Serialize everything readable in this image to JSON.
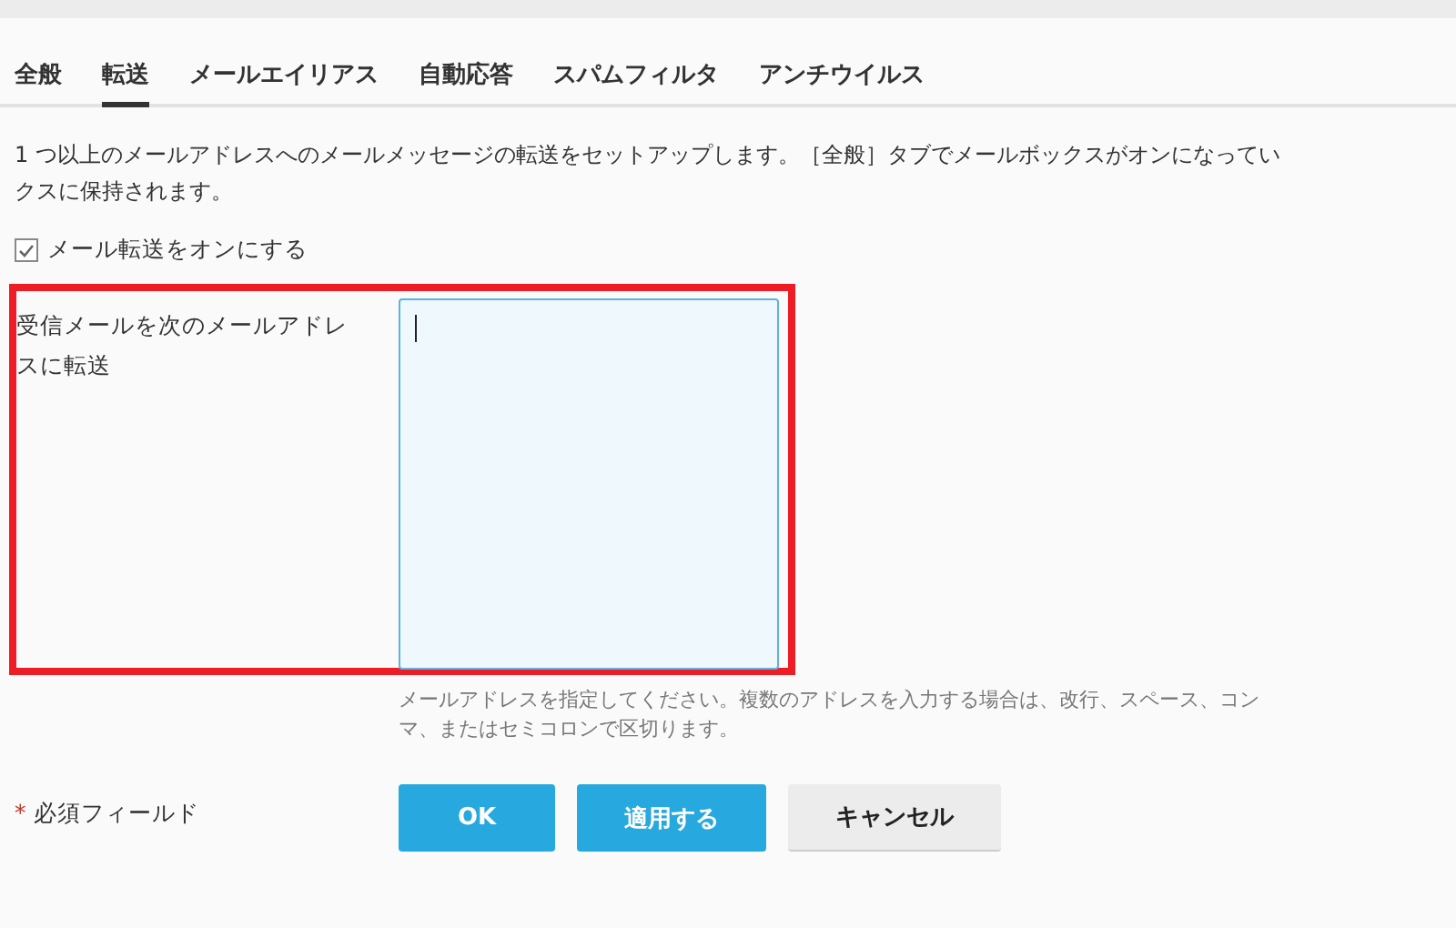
{
  "tabs": [
    {
      "label": "全般",
      "selected": false
    },
    {
      "label": "転送",
      "selected": true
    },
    {
      "label": "メールエイリアス",
      "selected": false
    },
    {
      "label": "自動応答",
      "selected": false
    },
    {
      "label": "スパムフィルタ",
      "selected": false
    },
    {
      "label": "アンチウイルス",
      "selected": false
    }
  ],
  "description": [
    "1 つ以上のメールアドレスへのメールメッセージの転送をセットアップします。［全般］タブでメールボックスがオンになってい",
    "クスに保持されます。"
  ],
  "forwarding_toggle": {
    "label": "メール転送をオンにする",
    "checked": true
  },
  "forward_section": {
    "highlighted": true,
    "label": "受信メールを次のメールアドレスに転送",
    "focused": true,
    "hint": "メールアドレスを指定してください。複数のアドレスを入力する場合は、改行、スペース、コンマ、またはセミコロンで区切ります。"
  },
  "required_note": {
    "mark": "*",
    "label": "必須フィールド"
  },
  "buttons": [
    {
      "label": "OK",
      "kind": "primary"
    },
    {
      "label": "適用する",
      "kind": "primary"
    },
    {
      "label": "キャンセル",
      "kind": "secondary"
    }
  ]
}
